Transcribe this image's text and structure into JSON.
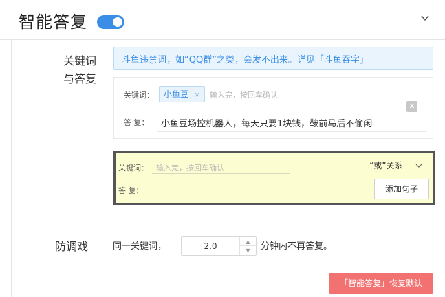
{
  "header": {
    "title": "智能答复",
    "toggle_state": "on",
    "toggle_color": "#3a8ee6"
  },
  "keywords_section": {
    "label_line1": "关键词",
    "label_line2": "与答复",
    "notice": "斗鱼违禁词，如“QQ群”之类，会发不出来。详见「斗鱼吞字」",
    "entries": [
      {
        "keyword_label": "关键词：",
        "tags": [
          "小鱼豆"
        ],
        "tag_remove": "×",
        "keyword_placeholder": "输入完，按回车确认",
        "reply_label": "答 复：",
        "reply": "小鱼豆场控机器人，每天只要1块钱，鞍前马后不偷闲"
      }
    ],
    "new_entry": {
      "keyword_label": "关键词：",
      "keyword_placeholder": "输入完，按回车确认",
      "relation": "“或”关系",
      "reply_label": "答 复：",
      "add_button": "添加句子",
      "highlight_color": "#fdfdd2"
    }
  },
  "anti_spam": {
    "label": "防调戏",
    "prefix": "同一关键词，",
    "minutes": "2.0",
    "suffix": "分钟内不再答复。"
  },
  "footer": {
    "restore_button": "「智能答复」恢复默认",
    "restore_color": "#f27171"
  }
}
